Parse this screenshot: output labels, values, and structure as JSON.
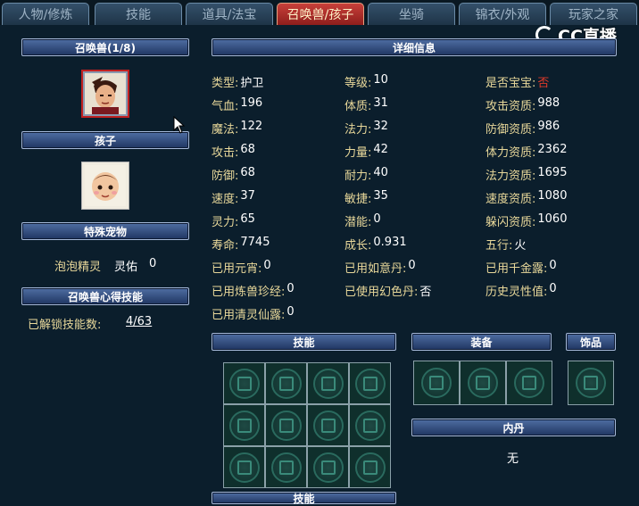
{
  "tabs": [
    {
      "label": "人物/修炼",
      "active": false
    },
    {
      "label": "技能",
      "active": false
    },
    {
      "label": "道具/法宝",
      "active": false
    },
    {
      "label": "召唤兽/孩子",
      "active": true
    },
    {
      "label": "坐骑",
      "active": false
    },
    {
      "label": "锦衣/外观",
      "active": false
    },
    {
      "label": "玩家之家",
      "active": false
    }
  ],
  "logo": "CC直播",
  "left": {
    "summon_header": "召唤兽(1/8)",
    "child_header": "孩子",
    "pet_header": "特殊宠物",
    "pet_name": "泡泡精灵",
    "pet_stat_label": "灵佑",
    "pet_stat_value": "0",
    "skills_header": "召唤兽心得技能",
    "unlocked_label": "已解锁技能数:",
    "unlocked_value": "4/63"
  },
  "detail": {
    "header": "详细信息",
    "col1": [
      {
        "label": "类型:",
        "value": "护卫"
      },
      {
        "label": "气血:",
        "value": "196"
      },
      {
        "label": "魔法:",
        "value": "122"
      },
      {
        "label": "攻击:",
        "value": "68"
      },
      {
        "label": "防御:",
        "value": "68"
      },
      {
        "label": "速度:",
        "value": "37"
      },
      {
        "label": "灵力:",
        "value": "65"
      },
      {
        "label": "寿命:",
        "value": "7745"
      },
      {
        "label": "已用元宵:",
        "value": "0"
      },
      {
        "label": "已用炼兽珍经:",
        "value": "0"
      },
      {
        "label": "已用清灵仙露:",
        "value": "0"
      }
    ],
    "col2": [
      {
        "label": "等级:",
        "value": "10"
      },
      {
        "label": "体质:",
        "value": "31"
      },
      {
        "label": "法力:",
        "value": "32"
      },
      {
        "label": "力量:",
        "value": "42"
      },
      {
        "label": "耐力:",
        "value": "40"
      },
      {
        "label": "敏捷:",
        "value": "35"
      },
      {
        "label": "潜能:",
        "value": "0"
      },
      {
        "label": "成长:",
        "value": "0.931"
      },
      {
        "label": "已用如意丹:",
        "value": "0"
      },
      {
        "label": "已使用幻色丹:",
        "value": "否"
      }
    ],
    "col3": [
      {
        "label": "是否宝宝:",
        "value": "否"
      },
      {
        "label": "攻击资质:",
        "value": "988"
      },
      {
        "label": "防御资质:",
        "value": "986"
      },
      {
        "label": "体力资质:",
        "value": "2362"
      },
      {
        "label": "法力资质:",
        "value": "1695"
      },
      {
        "label": "速度资质:",
        "value": "1080"
      },
      {
        "label": "躲闪资质:",
        "value": "1060"
      },
      {
        "label": "五行:",
        "value": "火"
      },
      {
        "label": "已用千金露:",
        "value": "0"
      },
      {
        "label": "历史灵性值:",
        "value": "0"
      }
    ]
  },
  "sections": {
    "skills": "技能",
    "equipment": "装备",
    "accessory": "饰品",
    "neidan": "内丹",
    "neidan_value": "无",
    "bottom": "技能"
  },
  "icons": {
    "slot_icon": "rune-icon",
    "cursor": "pointer-cursor-icon"
  },
  "colors": {
    "label": "#e8d89a",
    "value": "#ffffff",
    "highlight": "#e03a2a",
    "active_tab": "#b8302c"
  }
}
